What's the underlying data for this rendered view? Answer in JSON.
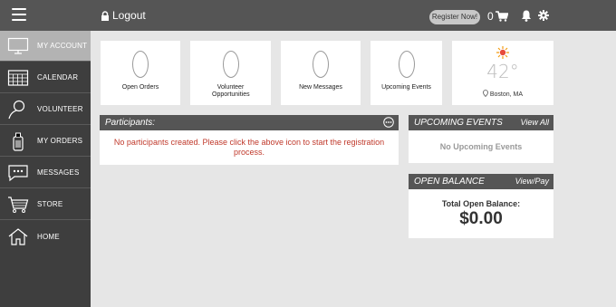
{
  "topbar": {
    "logout_label": "Logout",
    "register_label": "Register Now!",
    "cart_count": "0"
  },
  "sidebar": {
    "items": [
      {
        "label": "MY ACCOUNT",
        "icon": "monitor-icon",
        "active": true
      },
      {
        "label": "CALENDAR",
        "icon": "calendar-icon",
        "active": false
      },
      {
        "label": "VOLUNTEER",
        "icon": "volunteer-icon",
        "active": false
      },
      {
        "label": "MY ORDERS",
        "icon": "orders-icon",
        "active": false
      },
      {
        "label": "MESSAGES",
        "icon": "messages-icon",
        "active": false
      },
      {
        "label": "STORE",
        "icon": "store-cart-icon",
        "active": false
      },
      {
        "label": "HOME",
        "icon": "home-icon",
        "active": false
      }
    ]
  },
  "stats": [
    {
      "label": "Open Orders"
    },
    {
      "label": "Volunteer Opportunities"
    },
    {
      "label": "New Messages"
    },
    {
      "label": "Upcoming Events"
    }
  ],
  "weather": {
    "temp": "42°",
    "city": "Boston, MA",
    "icon": "sun-icon"
  },
  "participants": {
    "title": "Participants:",
    "message": "No participants created. Please click the above icon to start the registration process."
  },
  "upcoming": {
    "title": "UPCOMING EVENTS",
    "action": "View All",
    "empty": "No Upcoming Events"
  },
  "balance": {
    "title": "OPEN BALANCE",
    "action": "View/Pay",
    "label": "Total Open Balance:",
    "value": "$0.00"
  },
  "colors": {
    "topbar": "#555555",
    "sidebar": "#3e3e3e",
    "active_item": "#b3b3b3",
    "error_text": "#c0392b"
  }
}
